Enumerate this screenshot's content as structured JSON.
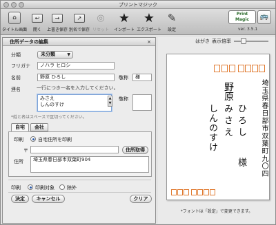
{
  "window": {
    "title": "プリントマジック"
  },
  "toolbar": {
    "items": [
      {
        "label": "タイトル画面",
        "icon": "home-icon",
        "glyph": "⌂"
      },
      {
        "label": "開く",
        "icon": "open-icon",
        "glyph": "↩"
      },
      {
        "label": "上書き保存",
        "icon": "save-icon",
        "glyph": "→"
      },
      {
        "label": "別名で保存",
        "icon": "save-as-icon",
        "glyph": "↗"
      },
      {
        "label": "リセット",
        "icon": "reset-icon",
        "glyph": "◎"
      },
      {
        "label": "インポート",
        "icon": "import-star-icon",
        "glyph": "★"
      },
      {
        "label": "エクスポート",
        "icon": "export-star-icon",
        "glyph": "★"
      },
      {
        "label": "設定",
        "icon": "wrench-icon",
        "glyph": "✎"
      }
    ],
    "brand": {
      "name": "Print Magic",
      "version": "ver. 3.5.1"
    }
  },
  "panel": {
    "title": "住所データの編集",
    "close_label": "×",
    "category_label": "分類",
    "category_value": "未分類",
    "furigana_label": "フリガナ",
    "furigana_value": "ノハラ ヒロシ",
    "name_label": "名前",
    "name_value": "野原 ひろし",
    "honorific_label": "敬称",
    "honorific_value": "様",
    "joint_label": "連名",
    "joint_placeholder": "一行につき一名を入力してください。",
    "joint_lines": [
      "みさえ",
      "しんのすけ"
    ],
    "joint_honorific_label": "敬称",
    "hint": "*姓と名はスペースで区切ってください。",
    "tabs": [
      "自宅",
      "会社"
    ],
    "print_label": "印刷",
    "print_home_option": "自宅住所を印刷",
    "zip_label": "〒",
    "zip_value": "",
    "address_lookup_button": "住所取得",
    "address_label": "住所",
    "address_value": "埼玉県春日部市双葉町904",
    "print_target_label": "印刷",
    "print_target_options": [
      "印刷対象",
      "除外"
    ],
    "confirm_button": "決定",
    "cancel_button": "キャンセル",
    "clear_button": "クリア"
  },
  "preview": {
    "postcard_label": "はがき",
    "display_size_label": "表示倍率",
    "address": "埼玉県春日部市双葉町九〇四",
    "surname": "野原",
    "names": [
      {
        "given": "ひろし",
        "honorific": "様"
      },
      {
        "given": "みさえ",
        "honorific": ""
      },
      {
        "given": "しんのすけ",
        "honorific": ""
      }
    ],
    "font_note": "*フォントは「設定」で変更できます。",
    "accent_color": "#e07a30"
  }
}
